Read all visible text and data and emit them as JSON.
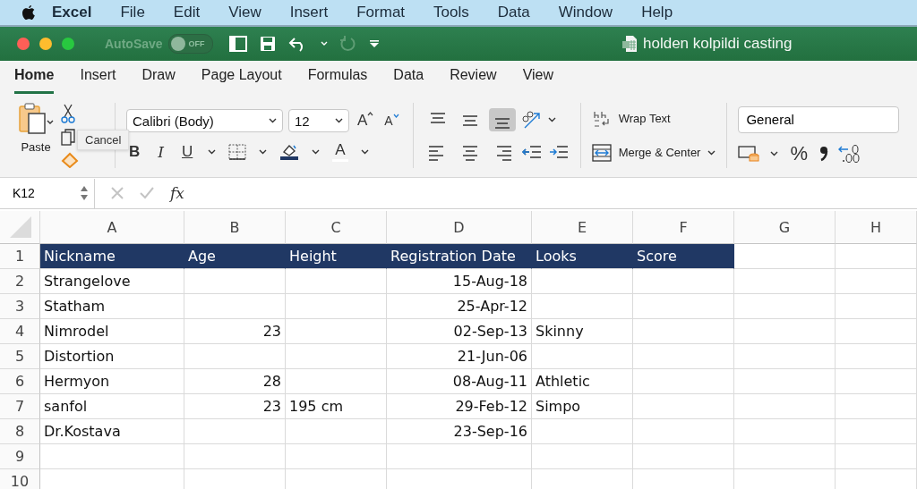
{
  "menu_bar": {
    "app": "Excel",
    "items": [
      "File",
      "Edit",
      "View",
      "Insert",
      "Format",
      "Tools",
      "Data",
      "Window",
      "Help"
    ]
  },
  "title_bar": {
    "autosave": {
      "label": "AutoSave",
      "state_text": "OFF",
      "on": false
    },
    "title": "holden kolpildi casting"
  },
  "ribbon_tabs": [
    {
      "label": "Home",
      "selected": true
    },
    {
      "label": "Insert",
      "selected": false
    },
    {
      "label": "Draw",
      "selected": false
    },
    {
      "label": "Page Layout",
      "selected": false
    },
    {
      "label": "Formulas",
      "selected": false
    },
    {
      "label": "Data",
      "selected": false
    },
    {
      "label": "Review",
      "selected": false
    },
    {
      "label": "View",
      "selected": false
    }
  ],
  "ribbon": {
    "paste_label": "Paste",
    "tooltip": "Cancel",
    "font": "Calibri (Body)",
    "font_size": "12",
    "grow_font": "A",
    "shrink_font": "A",
    "style_buttons": [
      "B",
      "I",
      "U"
    ],
    "font_color_label": "A",
    "vertical_align": [
      {
        "selected": false
      },
      {
        "selected": false
      },
      {
        "selected": true
      }
    ],
    "wrap_text": "Wrap Text",
    "merge_center": "Merge & Center",
    "number_format": "General",
    "percent": "%"
  },
  "formula_bar": {
    "name_box": "K12",
    "fx": "fx"
  },
  "sheet": {
    "columns": [
      "A",
      "B",
      "C",
      "D",
      "E",
      "F",
      "G",
      "H"
    ],
    "header": {
      "number": "1",
      "cells": [
        "Nickname",
        "Age",
        "Height",
        "Registration Date",
        "Looks",
        "Score"
      ]
    },
    "rows": [
      {
        "number": "2",
        "cells": [
          "Strangelove",
          null,
          null,
          "15-Aug-18",
          null,
          null
        ]
      },
      {
        "number": "3",
        "cells": [
          "Statham",
          null,
          null,
          "25-Apr-12",
          null,
          null
        ]
      },
      {
        "number": "4",
        "cells": [
          "Nimrodel",
          "23",
          null,
          "02-Sep-13",
          "Skinny",
          null
        ]
      },
      {
        "number": "5",
        "cells": [
          "Distortion",
          null,
          null,
          "21-Jun-06",
          null,
          null
        ]
      },
      {
        "number": "6",
        "cells": [
          "Hermyon",
          "28",
          null,
          "08-Aug-11",
          "Athletic",
          null
        ]
      },
      {
        "number": "7",
        "cells": [
          "sanfol",
          "23",
          "195 cm",
          "29-Feb-12",
          "Simpo",
          null
        ]
      },
      {
        "number": "8",
        "cells": [
          "Dr.Kostava",
          null,
          null,
          "23-Sep-16",
          null,
          null
        ]
      },
      {
        "number": "9",
        "cells": [
          null,
          null,
          null,
          null,
          null,
          null
        ]
      },
      {
        "number": "10",
        "cells": [
          null,
          null,
          null,
          null,
          null,
          null
        ]
      }
    ]
  }
}
